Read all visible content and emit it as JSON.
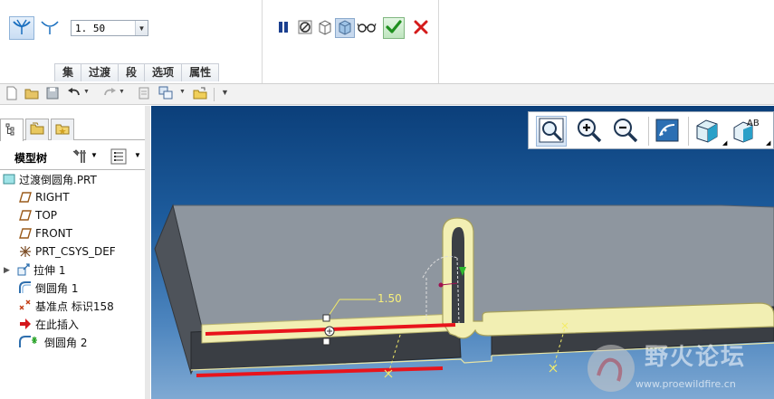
{
  "dashboard": {
    "radius_value": "1. 50",
    "panel_tabs": [
      {
        "label": "集"
      },
      {
        "label": "过渡"
      },
      {
        "label": "段"
      },
      {
        "label": "选项"
      },
      {
        "label": "属性"
      }
    ],
    "icons": {
      "set_mode": "round-set-mode-icon",
      "transition_mode": "transition-mode-icon",
      "pause": "pause-icon",
      "no_preview": "no-preview-icon",
      "preview": "geometry-preview-icon",
      "verify": "verify-mode-icon",
      "glasses": "glasses-preview-icon",
      "ok": "check-icon",
      "cancel": "close-icon"
    }
  },
  "model_tree": {
    "title": "模型树",
    "items": [
      {
        "label": "过渡倒圆角.PRT",
        "icon": "part-icon"
      },
      {
        "label": "RIGHT",
        "icon": "datum-plane-icon"
      },
      {
        "label": "TOP",
        "icon": "datum-plane-icon"
      },
      {
        "label": "FRONT",
        "icon": "datum-plane-icon"
      },
      {
        "label": "PRT_CSYS_DEF",
        "icon": "csys-icon"
      },
      {
        "label": "拉伸 1",
        "icon": "extrude-icon"
      },
      {
        "label": "倒圆角 1",
        "icon": "round-icon"
      },
      {
        "label": "基准点 标识158",
        "icon": "datum-point-icon"
      },
      {
        "label": "在此插入",
        "icon": "insert-here-arrow-icon"
      },
      {
        "label": "倒圆角 2",
        "icon": "round-active-icon"
      }
    ]
  },
  "graphics": {
    "dimension_label": "1.50",
    "watermark": {
      "title": "野火论坛",
      "url": "www.proewildfire.cn"
    }
  },
  "colors": {
    "viewport_top": "#0b3f7a",
    "viewport_bottom": "#7fa9d3",
    "highlight_edge": "#e8141c",
    "round_surface": "#f2efb3",
    "ok_green": "#1e8f1e",
    "cancel_red": "#d41b1b"
  }
}
